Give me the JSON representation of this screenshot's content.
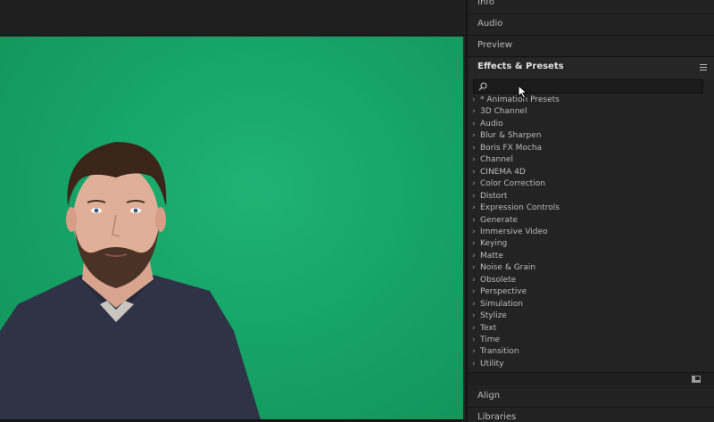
{
  "panels": {
    "info": "Info",
    "audio": "Audio",
    "preview": "Preview",
    "align": "Align",
    "libraries": "Libraries"
  },
  "effects": {
    "title": "Effects & Presets",
    "search_value": "",
    "search_placeholder": "",
    "items": [
      "* Animation Presets",
      "3D Channel",
      "Audio",
      "Blur & Sharpen",
      "Boris FX Mocha",
      "Channel",
      "CINEMA 4D",
      "Color Correction",
      "Distort",
      "Expression Controls",
      "Generate",
      "Immersive Video",
      "Keying",
      "Matte",
      "Noise & Grain",
      "Obsolete",
      "Perspective",
      "Simulation",
      "Stylize",
      "Text",
      "Time",
      "Transition",
      "Utility"
    ]
  },
  "icons": {
    "chevron": "chevron-right-icon",
    "menu": "hamburger-menu-icon",
    "search": "search-icon",
    "new_folder": "new-folder-icon"
  },
  "colors": {
    "green_screen": "#17a468",
    "panel_bg": "#232323",
    "text": "#bcbcbc"
  }
}
